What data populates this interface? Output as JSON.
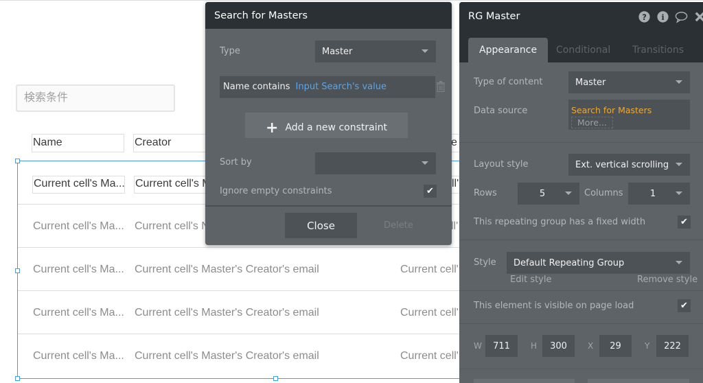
{
  "canvas": {
    "search_input": {
      "placeholder": "検索条件",
      "value": ""
    },
    "table_headers": [
      "Name",
      "Creator",
      "e"
    ],
    "rows": [
      {
        "name": "Current cell's Ma...",
        "creator": "Current cell's M",
        "third": "ll'"
      },
      {
        "name": "Current cell's Ma...",
        "creator": "Current cell's N",
        "third": "ll'"
      },
      {
        "name": "Current cell's Ma...",
        "creator": "Current cell's Master's Creator's email",
        "third": "Current cell'"
      },
      {
        "name": "Current cell's Ma...",
        "creator": "Current cell's Master's Creator's email",
        "third": "Current cell'"
      },
      {
        "name": "Current cell's Ma...",
        "creator": "Current cell's Master's Creator's email",
        "third": "Current cell'"
      }
    ]
  },
  "search_popup": {
    "title": "Search for Masters",
    "type_label": "Type",
    "type_value": "Master",
    "constraint": {
      "field": "Name contains",
      "value": "Input Search's value"
    },
    "add_constraint_label": "Add a new constraint",
    "sort_by_label": "Sort by",
    "sort_by_value": "",
    "ignore_empty_label": "Ignore empty constraints",
    "ignore_empty_checked": true,
    "close_label": "Close",
    "delete_label": "Delete"
  },
  "editor": {
    "title": "RG Master",
    "header_icons": [
      "help-icon",
      "info-icon",
      "comment-icon",
      "close-icon"
    ],
    "tabs": [
      {
        "label": "Appearance",
        "active": true
      },
      {
        "label": "Conditional",
        "active": false
      },
      {
        "label": "Transitions",
        "active": false
      }
    ],
    "type_of_content_label": "Type of content",
    "type_of_content_value": "Master",
    "data_source_label": "Data source",
    "data_source_value": "Search for Masters",
    "data_source_more": "More...",
    "layout_style_label": "Layout style",
    "layout_style_value": "Ext. vertical scrolling",
    "rows_label": "Rows",
    "rows_value": "5",
    "columns_label": "Columns",
    "columns_value": "1",
    "fixed_width_label": "This repeating group has a fixed width",
    "fixed_width_checked": true,
    "style_label": "Style",
    "style_value": "Default Repeating Group",
    "edit_style_label": "Edit style",
    "remove_style_label": "Remove style",
    "visible_label": "This element is visible on page load",
    "visible_checked": true,
    "geometry": {
      "w_label": "W",
      "w": "711",
      "h_label": "H",
      "h": "300",
      "x_label": "X",
      "x": "29",
      "y_label": "Y",
      "y": "222"
    }
  },
  "colors": {
    "panel_bg": "#5e6368",
    "panel_header": "#2a3033",
    "field_bg": "#4d5256",
    "link_blue": "#5aa6e8",
    "accent_orange": "#f0a830",
    "selection_blue": "#4a9ae0"
  }
}
